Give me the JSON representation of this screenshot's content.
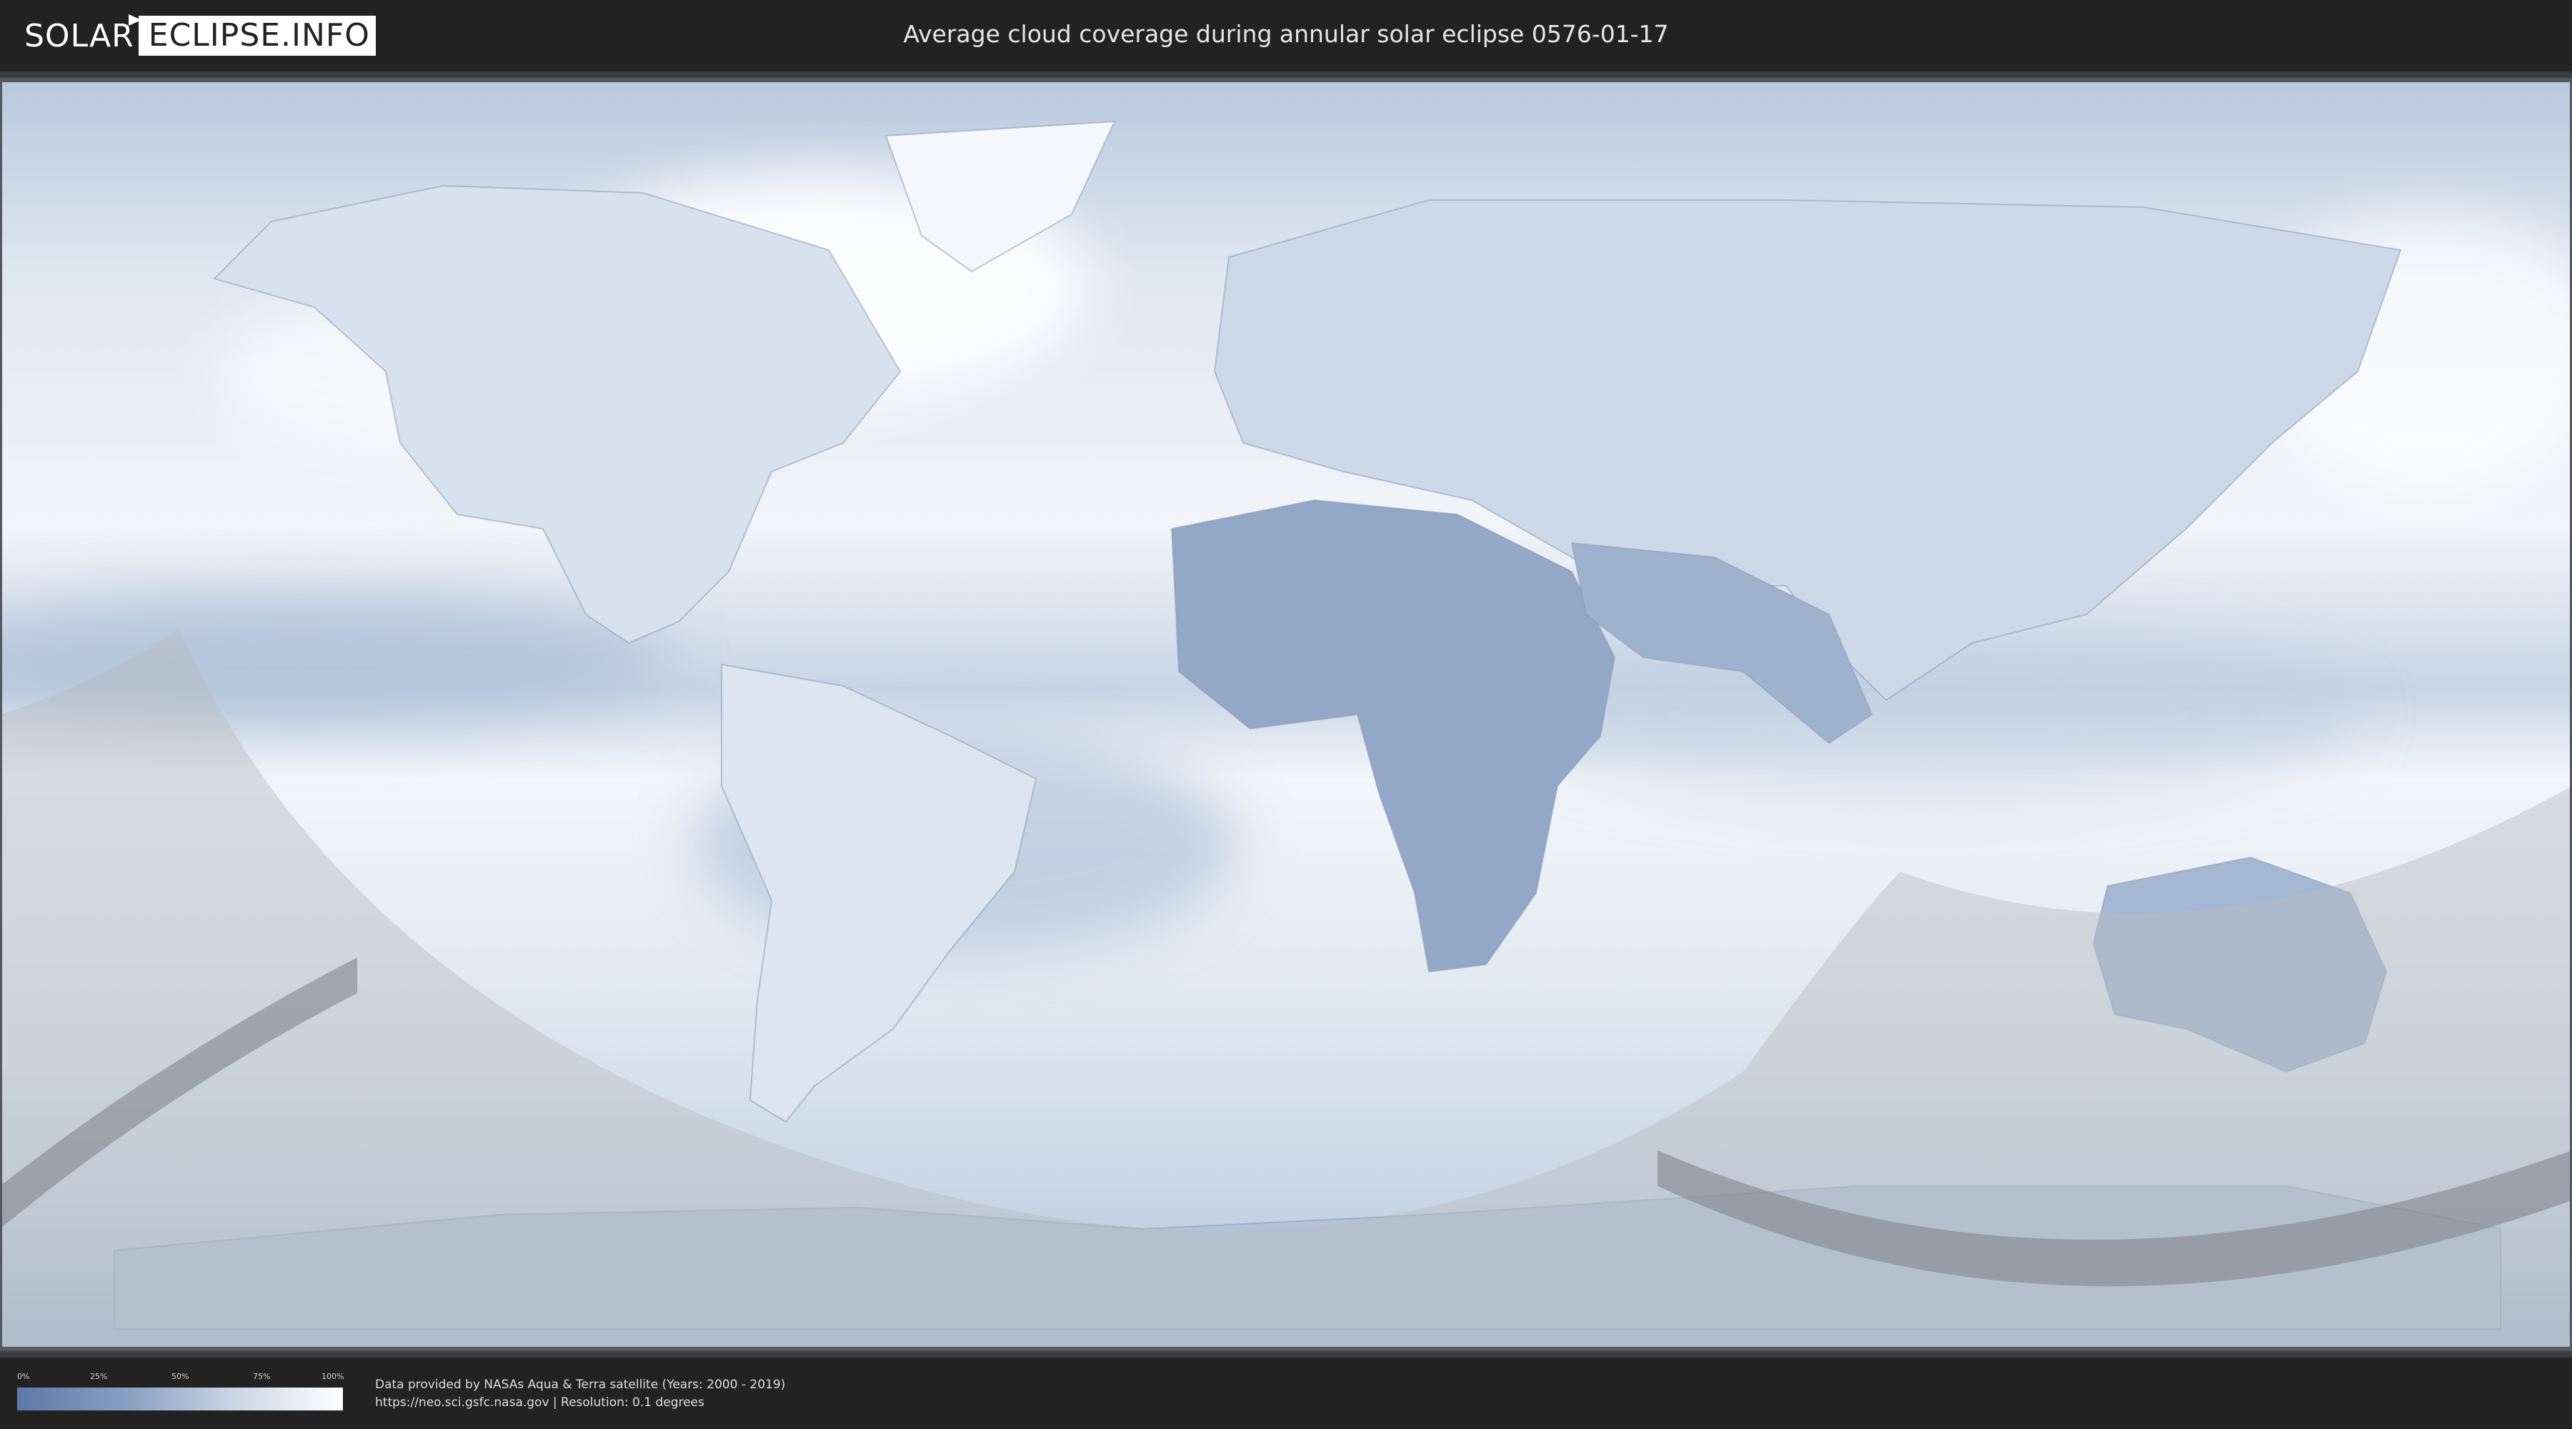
{
  "header": {
    "logo_left": "SOLAR",
    "logo_right": "ECLIPSE.INFO",
    "title": "Average cloud coverage during annular solar eclipse 0576-01-17"
  },
  "legend": {
    "ticks": [
      "0%",
      "25%",
      "50%",
      "75%",
      "100%"
    ],
    "colors": [
      "#5c79a6",
      "#8aa1c3",
      "#c7d3e4",
      "#ffffff"
    ]
  },
  "footer": {
    "line1": "Data provided by NASAs Aqua & Terra satellite (Years: 2000 - 2019)",
    "line2": "https://neo.sci.gsfc.nasa.gov | Resolution: 0.1 degrees"
  }
}
